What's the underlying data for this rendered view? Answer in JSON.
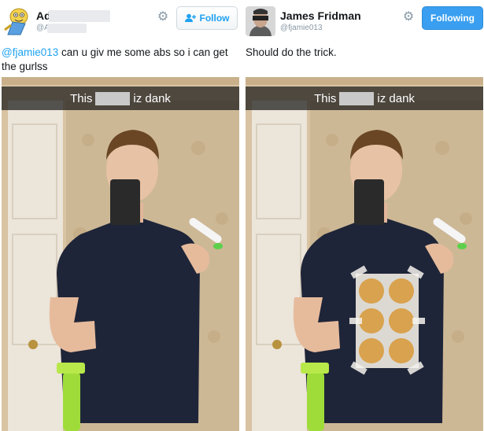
{
  "left": {
    "name": "Ad",
    "handle": "@A",
    "follow_label": "Follow",
    "tweet": {
      "mention": "@fjamie013",
      "text": " can u giv me some abs so i can get the gurlss"
    },
    "caption": {
      "before": "This",
      "after": "iz dank"
    }
  },
  "right": {
    "name": "James Fridman",
    "handle": "@fjamie013",
    "following_label": "Following",
    "tweet": {
      "text": "Should do the trick."
    },
    "caption": {
      "before": "This",
      "after": "iz dank"
    }
  },
  "colors": {
    "accent": "#1da1f2",
    "following_bg": "#3a9ff0",
    "caption_bg": "#191919"
  },
  "icons": [
    "cartoon-avatar-icon",
    "gear-icon",
    "add-user-icon",
    "profile-photo-icon"
  ]
}
